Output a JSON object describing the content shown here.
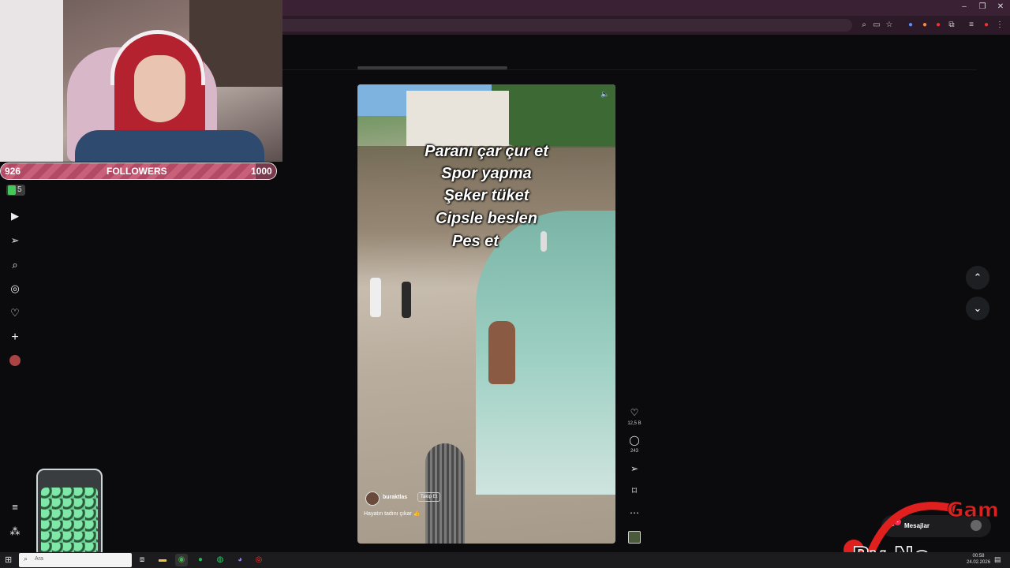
{
  "webcam": {
    "followers_current": "926",
    "followers_label": "FOLLOWERS",
    "followers_goal": "1000",
    "progress": 0.926
  },
  "overlay_badge": "5",
  "video": {
    "caption_lines": [
      "Paranı çar çur et",
      "Spor yapma",
      "Şeker tüket",
      "Cipsle beslen",
      "Pes et"
    ],
    "author": "buraktlas",
    "follow_label": "Takip Et",
    "description": "Hayatın tadını çıkar 👍",
    "likes": "12,5 B",
    "comments": "243"
  },
  "messages": {
    "label": "Mesajlar",
    "badge": "1"
  },
  "logo": {
    "text": "By No Gam"
  },
  "taskbar": {
    "search_placeholder": "Ara",
    "time": "00:58",
    "date": "24.02.2026"
  },
  "icons": {
    "home": "play-box-icon",
    "explore": "send-icon",
    "search": "search-icon",
    "compass": "compass-icon",
    "heart": "heart-icon",
    "plus": "plus-icon",
    "menu": "hamburger-icon",
    "apps": "apps-icon"
  },
  "colors": {
    "accent": "#ff2d55",
    "followers_bar": "#c9607a",
    "titlebar": "#3a2234"
  }
}
